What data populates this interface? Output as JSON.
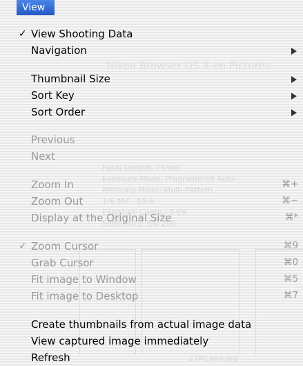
{
  "menubar": {
    "title": "View"
  },
  "background_window": {
    "title": "Nikon Browser OS X-en Pictures",
    "lines": [
      "Focal Length: 75mm",
      "Exposure Mode: Programmed Auto",
      "Metering Mode: Multi-Pattern",
      "1/6 sec - f/5.6",
      "Exposure Comp.: 0 EV",
      "Sensitivity: ISO 200"
    ],
    "file_label": "Z7MLane.jpg"
  },
  "menu": {
    "items": [
      {
        "label": "View Shooting Data",
        "checked": true,
        "enabled": true
      },
      {
        "label": "Navigation",
        "enabled": true,
        "submenu": true
      },
      {
        "label": "Thumbnail Size",
        "enabled": true,
        "submenu": true
      },
      {
        "label": "Sort Key",
        "enabled": true,
        "submenu": true
      },
      {
        "label": "Sort Order",
        "enabled": true,
        "submenu": true
      },
      {
        "label": "Previous",
        "enabled": false
      },
      {
        "label": "Next",
        "enabled": false
      },
      {
        "label": "Zoom In",
        "enabled": false,
        "shortcut": "⌘+"
      },
      {
        "label": "Zoom Out",
        "enabled": false,
        "shortcut": "⌘−"
      },
      {
        "label": "Display at the Original Size",
        "enabled": false,
        "shortcut": "⌘*"
      },
      {
        "label": "Zoom Cursor",
        "checked": true,
        "enabled": false,
        "shortcut": "⌘9"
      },
      {
        "label": "Grab Cursor",
        "enabled": false,
        "shortcut": "⌘0"
      },
      {
        "label": "Fit image to Window",
        "enabled": false,
        "shortcut": "⌘5"
      },
      {
        "label": "Fit image to Desktop",
        "enabled": false,
        "shortcut": "⌘7"
      },
      {
        "label": "Create thumbnails from actual image data",
        "enabled": true
      },
      {
        "label": "View captured image immediately",
        "enabled": true
      },
      {
        "label": "Refresh",
        "enabled": true
      }
    ],
    "checkmark": "✓",
    "submenu_icon": "triangle-right-icon"
  }
}
